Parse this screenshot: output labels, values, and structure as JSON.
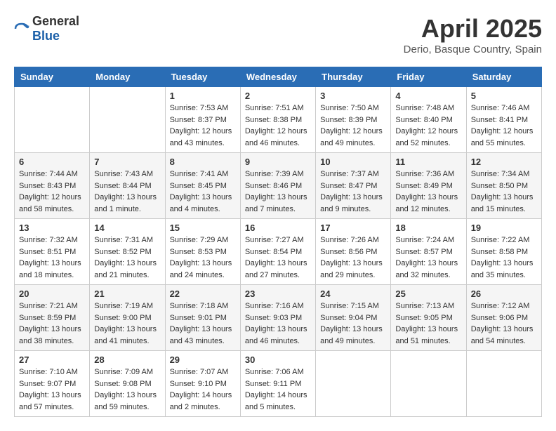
{
  "header": {
    "logo_general": "General",
    "logo_blue": "Blue",
    "month_year": "April 2025",
    "location": "Derio, Basque Country, Spain"
  },
  "weekdays": [
    "Sunday",
    "Monday",
    "Tuesday",
    "Wednesday",
    "Thursday",
    "Friday",
    "Saturday"
  ],
  "weeks": [
    [
      {
        "day": "",
        "sunrise": "",
        "sunset": "",
        "daylight": ""
      },
      {
        "day": "",
        "sunrise": "",
        "sunset": "",
        "daylight": ""
      },
      {
        "day": "1",
        "sunrise": "Sunrise: 7:53 AM",
        "sunset": "Sunset: 8:37 PM",
        "daylight": "Daylight: 12 hours and 43 minutes."
      },
      {
        "day": "2",
        "sunrise": "Sunrise: 7:51 AM",
        "sunset": "Sunset: 8:38 PM",
        "daylight": "Daylight: 12 hours and 46 minutes."
      },
      {
        "day": "3",
        "sunrise": "Sunrise: 7:50 AM",
        "sunset": "Sunset: 8:39 PM",
        "daylight": "Daylight: 12 hours and 49 minutes."
      },
      {
        "day": "4",
        "sunrise": "Sunrise: 7:48 AM",
        "sunset": "Sunset: 8:40 PM",
        "daylight": "Daylight: 12 hours and 52 minutes."
      },
      {
        "day": "5",
        "sunrise": "Sunrise: 7:46 AM",
        "sunset": "Sunset: 8:41 PM",
        "daylight": "Daylight: 12 hours and 55 minutes."
      }
    ],
    [
      {
        "day": "6",
        "sunrise": "Sunrise: 7:44 AM",
        "sunset": "Sunset: 8:43 PM",
        "daylight": "Daylight: 12 hours and 58 minutes."
      },
      {
        "day": "7",
        "sunrise": "Sunrise: 7:43 AM",
        "sunset": "Sunset: 8:44 PM",
        "daylight": "Daylight: 13 hours and 1 minute."
      },
      {
        "day": "8",
        "sunrise": "Sunrise: 7:41 AM",
        "sunset": "Sunset: 8:45 PM",
        "daylight": "Daylight: 13 hours and 4 minutes."
      },
      {
        "day": "9",
        "sunrise": "Sunrise: 7:39 AM",
        "sunset": "Sunset: 8:46 PM",
        "daylight": "Daylight: 13 hours and 7 minutes."
      },
      {
        "day": "10",
        "sunrise": "Sunrise: 7:37 AM",
        "sunset": "Sunset: 8:47 PM",
        "daylight": "Daylight: 13 hours and 9 minutes."
      },
      {
        "day": "11",
        "sunrise": "Sunrise: 7:36 AM",
        "sunset": "Sunset: 8:49 PM",
        "daylight": "Daylight: 13 hours and 12 minutes."
      },
      {
        "day": "12",
        "sunrise": "Sunrise: 7:34 AM",
        "sunset": "Sunset: 8:50 PM",
        "daylight": "Daylight: 13 hours and 15 minutes."
      }
    ],
    [
      {
        "day": "13",
        "sunrise": "Sunrise: 7:32 AM",
        "sunset": "Sunset: 8:51 PM",
        "daylight": "Daylight: 13 hours and 18 minutes."
      },
      {
        "day": "14",
        "sunrise": "Sunrise: 7:31 AM",
        "sunset": "Sunset: 8:52 PM",
        "daylight": "Daylight: 13 hours and 21 minutes."
      },
      {
        "day": "15",
        "sunrise": "Sunrise: 7:29 AM",
        "sunset": "Sunset: 8:53 PM",
        "daylight": "Daylight: 13 hours and 24 minutes."
      },
      {
        "day": "16",
        "sunrise": "Sunrise: 7:27 AM",
        "sunset": "Sunset: 8:54 PM",
        "daylight": "Daylight: 13 hours and 27 minutes."
      },
      {
        "day": "17",
        "sunrise": "Sunrise: 7:26 AM",
        "sunset": "Sunset: 8:56 PM",
        "daylight": "Daylight: 13 hours and 29 minutes."
      },
      {
        "day": "18",
        "sunrise": "Sunrise: 7:24 AM",
        "sunset": "Sunset: 8:57 PM",
        "daylight": "Daylight: 13 hours and 32 minutes."
      },
      {
        "day": "19",
        "sunrise": "Sunrise: 7:22 AM",
        "sunset": "Sunset: 8:58 PM",
        "daylight": "Daylight: 13 hours and 35 minutes."
      }
    ],
    [
      {
        "day": "20",
        "sunrise": "Sunrise: 7:21 AM",
        "sunset": "Sunset: 8:59 PM",
        "daylight": "Daylight: 13 hours and 38 minutes."
      },
      {
        "day": "21",
        "sunrise": "Sunrise: 7:19 AM",
        "sunset": "Sunset: 9:00 PM",
        "daylight": "Daylight: 13 hours and 41 minutes."
      },
      {
        "day": "22",
        "sunrise": "Sunrise: 7:18 AM",
        "sunset": "Sunset: 9:01 PM",
        "daylight": "Daylight: 13 hours and 43 minutes."
      },
      {
        "day": "23",
        "sunrise": "Sunrise: 7:16 AM",
        "sunset": "Sunset: 9:03 PM",
        "daylight": "Daylight: 13 hours and 46 minutes."
      },
      {
        "day": "24",
        "sunrise": "Sunrise: 7:15 AM",
        "sunset": "Sunset: 9:04 PM",
        "daylight": "Daylight: 13 hours and 49 minutes."
      },
      {
        "day": "25",
        "sunrise": "Sunrise: 7:13 AM",
        "sunset": "Sunset: 9:05 PM",
        "daylight": "Daylight: 13 hours and 51 minutes."
      },
      {
        "day": "26",
        "sunrise": "Sunrise: 7:12 AM",
        "sunset": "Sunset: 9:06 PM",
        "daylight": "Daylight: 13 hours and 54 minutes."
      }
    ],
    [
      {
        "day": "27",
        "sunrise": "Sunrise: 7:10 AM",
        "sunset": "Sunset: 9:07 PM",
        "daylight": "Daylight: 13 hours and 57 minutes."
      },
      {
        "day": "28",
        "sunrise": "Sunrise: 7:09 AM",
        "sunset": "Sunset: 9:08 PM",
        "daylight": "Daylight: 13 hours and 59 minutes."
      },
      {
        "day": "29",
        "sunrise": "Sunrise: 7:07 AM",
        "sunset": "Sunset: 9:10 PM",
        "daylight": "Daylight: 14 hours and 2 minutes."
      },
      {
        "day": "30",
        "sunrise": "Sunrise: 7:06 AM",
        "sunset": "Sunset: 9:11 PM",
        "daylight": "Daylight: 14 hours and 5 minutes."
      },
      {
        "day": "",
        "sunrise": "",
        "sunset": "",
        "daylight": ""
      },
      {
        "day": "",
        "sunrise": "",
        "sunset": "",
        "daylight": ""
      },
      {
        "day": "",
        "sunrise": "",
        "sunset": "",
        "daylight": ""
      }
    ]
  ]
}
